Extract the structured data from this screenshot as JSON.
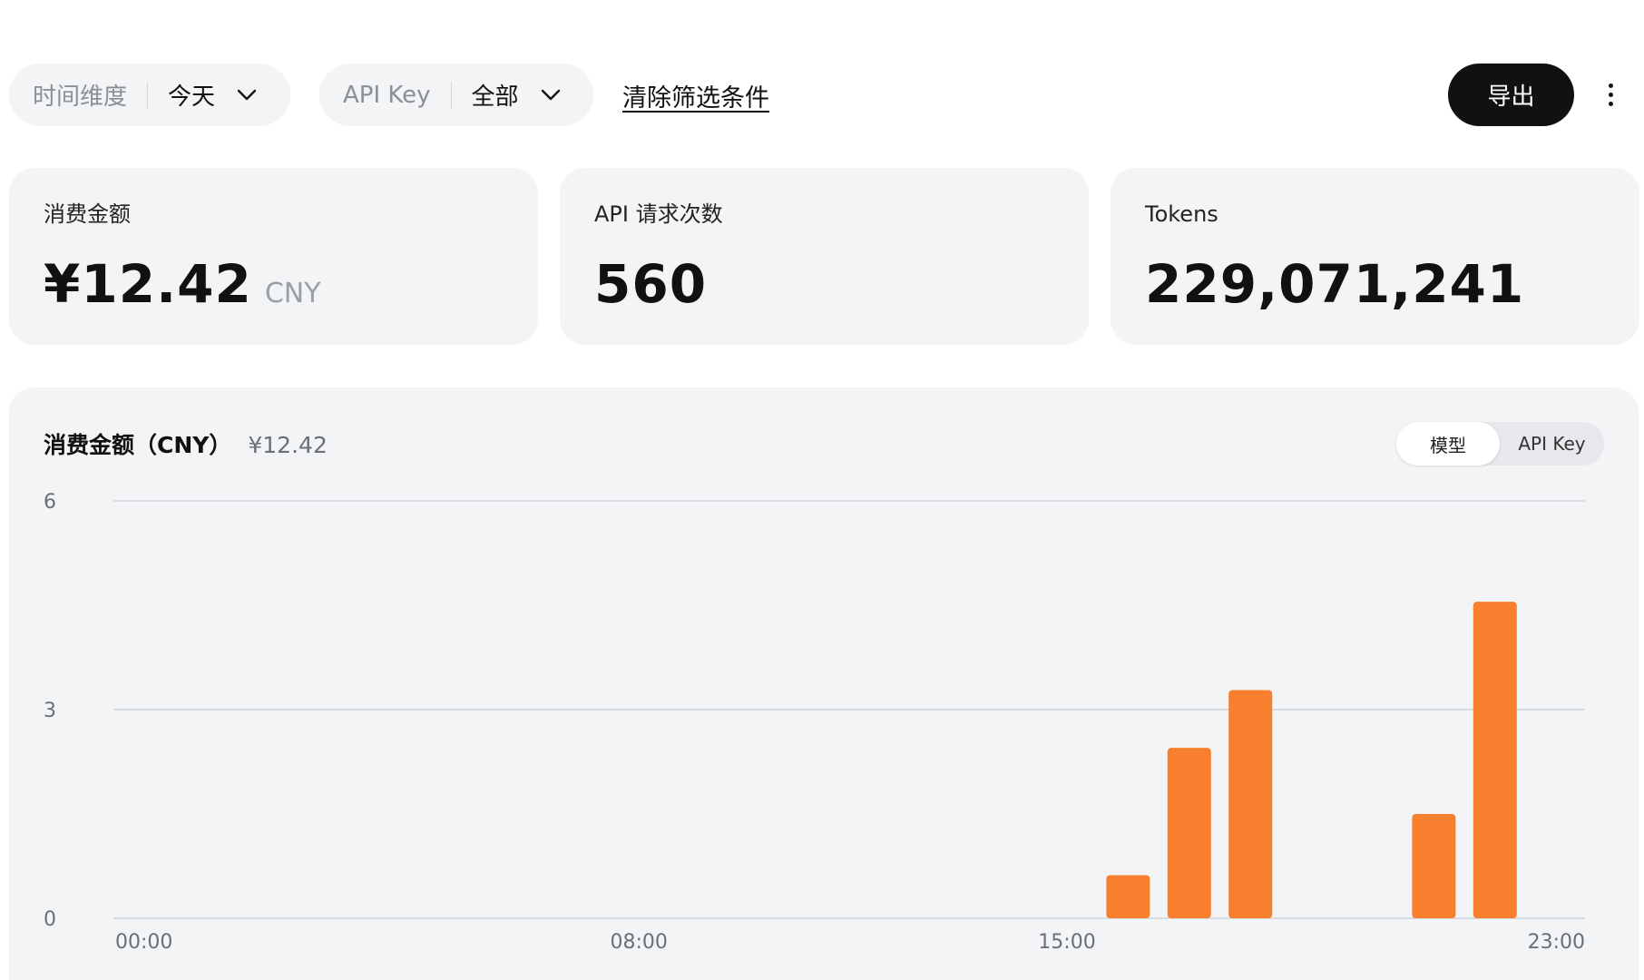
{
  "filters": {
    "time": {
      "label": "时间维度",
      "value": "今天"
    },
    "api_key": {
      "label": "API Key",
      "value": "全部"
    },
    "clear_label": "清除筛选条件",
    "export_label": "导出"
  },
  "stats": {
    "amount": {
      "title": "消费金额",
      "value": "¥12.42",
      "unit": "CNY"
    },
    "requests": {
      "title": "API 请求次数",
      "value": "560"
    },
    "tokens": {
      "title": "Tokens",
      "value": "229,071,241"
    }
  },
  "chart_panel": {
    "title": "消费金额（CNY）",
    "total": "¥12.42",
    "toggle": {
      "options": [
        "模型",
        "API Key"
      ],
      "selected": "模型"
    }
  },
  "colors": {
    "bar": "#f77f2e",
    "grid": "#cfd3d9",
    "text_muted": "#6b7078"
  },
  "chart_data": {
    "type": "bar",
    "x": [
      0,
      1,
      2,
      3,
      4,
      5,
      6,
      7,
      8,
      9,
      10,
      11,
      12,
      13,
      14,
      15,
      16,
      17,
      18,
      19,
      20,
      21,
      22,
      23
    ],
    "x_tick_labels": [
      "00:00",
      "08:00",
      "15:00",
      "23:00"
    ],
    "x_tick_positions": [
      0,
      8,
      15,
      23
    ],
    "values": [
      0,
      0,
      0,
      0,
      0,
      0,
      0,
      0,
      0,
      0,
      0,
      0,
      0,
      0,
      0,
      0,
      0.62,
      2.45,
      3.28,
      0,
      0,
      1.5,
      4.55,
      0
    ],
    "yticks": [
      0,
      3,
      6
    ],
    "ylim": [
      0,
      6
    ],
    "grid": true
  }
}
